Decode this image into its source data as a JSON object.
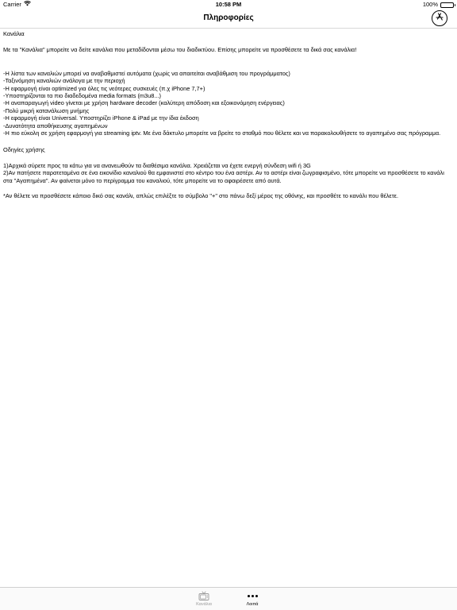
{
  "status_bar": {
    "carrier": "Carrier",
    "time": "10:58 PM",
    "battery": "100%"
  },
  "nav": {
    "title": "Πληροφορίες",
    "appstore_icon": "app-store-icon"
  },
  "content": {
    "section_channels": "Κανάλια",
    "intro": "Με τα \"Κανάλια\" μπορείτε να δείτε κανάλια που μεταδίδονται μέσω του διαδικτύου. Επίσης μπορείτε να προσθέσετε τα δικά σας κανάλια!",
    "features": [
      "-Η λίστα των καναλιών μπορεί να αναβαθμιστεί αυτόματα (χωρίς να απαιτείται αναβάθμιση του προγράμματος)",
      "-Ταξινόμηση καναλιών ανάλογα με την περιοχή",
      "-Η εφαρμογή είναι optimized για όλες τις νεότερες συσκευές (π.χ iPhone 7,7+)",
      "-Υποστηρίζονται τα πιο διαδεδομένα media formats (m3u8...)",
      "-Η αναπαραγωγή video γίνεται με χρήση hardware decoder (καλύτερη απόδοση και εξοικονόμηση ενέργειας)",
      "-Πολύ μικρή κατανάλωση μνήμης",
      "-Η εφαρμογή είναι Universal. Υποστηρίζει iPhone & iPad με την ίδια έκδοση",
      "-Δυνατότητα αποθήκευσης αγαπημένων",
      "-Η πιο εύκολη σε χρήση εφαρμογή για streaming iptv. Με ένα δάκτυλο μπορείτε να βρείτε το σταθμό που θέλετε και να παρακολουθήσετε το αγαπημένο σας πρόγραμμα."
    ],
    "section_instructions": "Οδηγίες χρήσης",
    "instructions": [
      "1)Αρχικά σύρετε προς τα κάτω για να ανανεωθούν τα διαθέσιμα κανάλια. Χρειάζεται να έχετε ενεργή σύνδεση wifi ή 3G",
      "2)Αν πατήσετε παρατεταμένα σε ένα εικονίδιο καναλιού θα εμφανιστεί στο κέντρο του ένα αστέρι. Αν το αστέρι είναι ζωγραφισμένο, τότε μπορείτε να προσθέσετε το κανάλι στα \"Αγαπημένα\". Αν φαίνεται μόνο το περίγραμμα του καναλιού, τότε μπορείτε να το αφαιρέσετε από αυτά."
    ],
    "note": "*Αν θέλετε να προσθέσετε κάποιο δικό σας κανάλι, απλώς επιλέξτε το σύμβολο \"+\" στο πάνω δεξί μέρος της οθόνης, και προσθέτε το κανάλι που θέλετε."
  },
  "tab_bar": {
    "tabs": [
      {
        "label": "Κανάλια",
        "icon": "tv-icon",
        "selected": false
      },
      {
        "label": "Λοιπά",
        "icon": "more-icon",
        "selected": true
      }
    ]
  }
}
